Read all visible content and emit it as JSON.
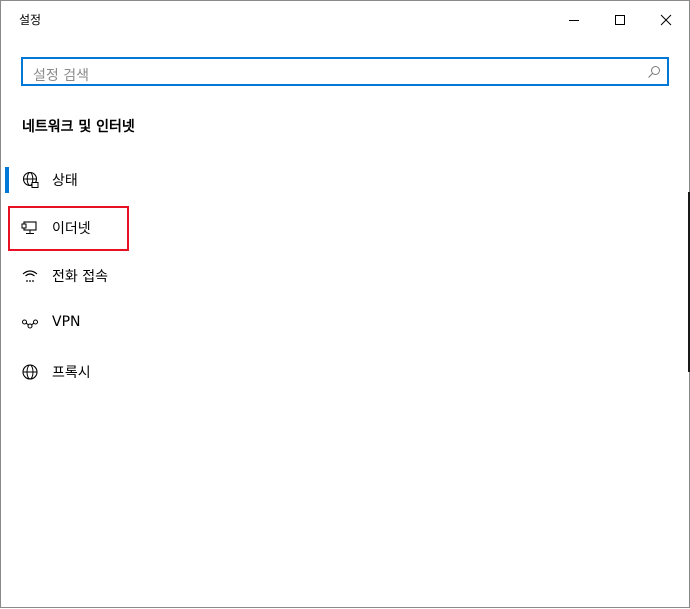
{
  "window": {
    "title": "설정"
  },
  "search": {
    "placeholder": "설정 검색"
  },
  "section": {
    "title": "네트워크 및 인터넷"
  },
  "nav": {
    "items": [
      {
        "label": "상태",
        "icon": "globe-network-icon"
      },
      {
        "label": "이더넷",
        "icon": "ethernet-icon"
      },
      {
        "label": "전화 접속",
        "icon": "dial-up-icon"
      },
      {
        "label": "VPN",
        "icon": "vpn-icon"
      },
      {
        "label": "프록시",
        "icon": "globe-icon"
      }
    ]
  },
  "colors": {
    "accent": "#0078d7",
    "highlight": "#e81123"
  }
}
